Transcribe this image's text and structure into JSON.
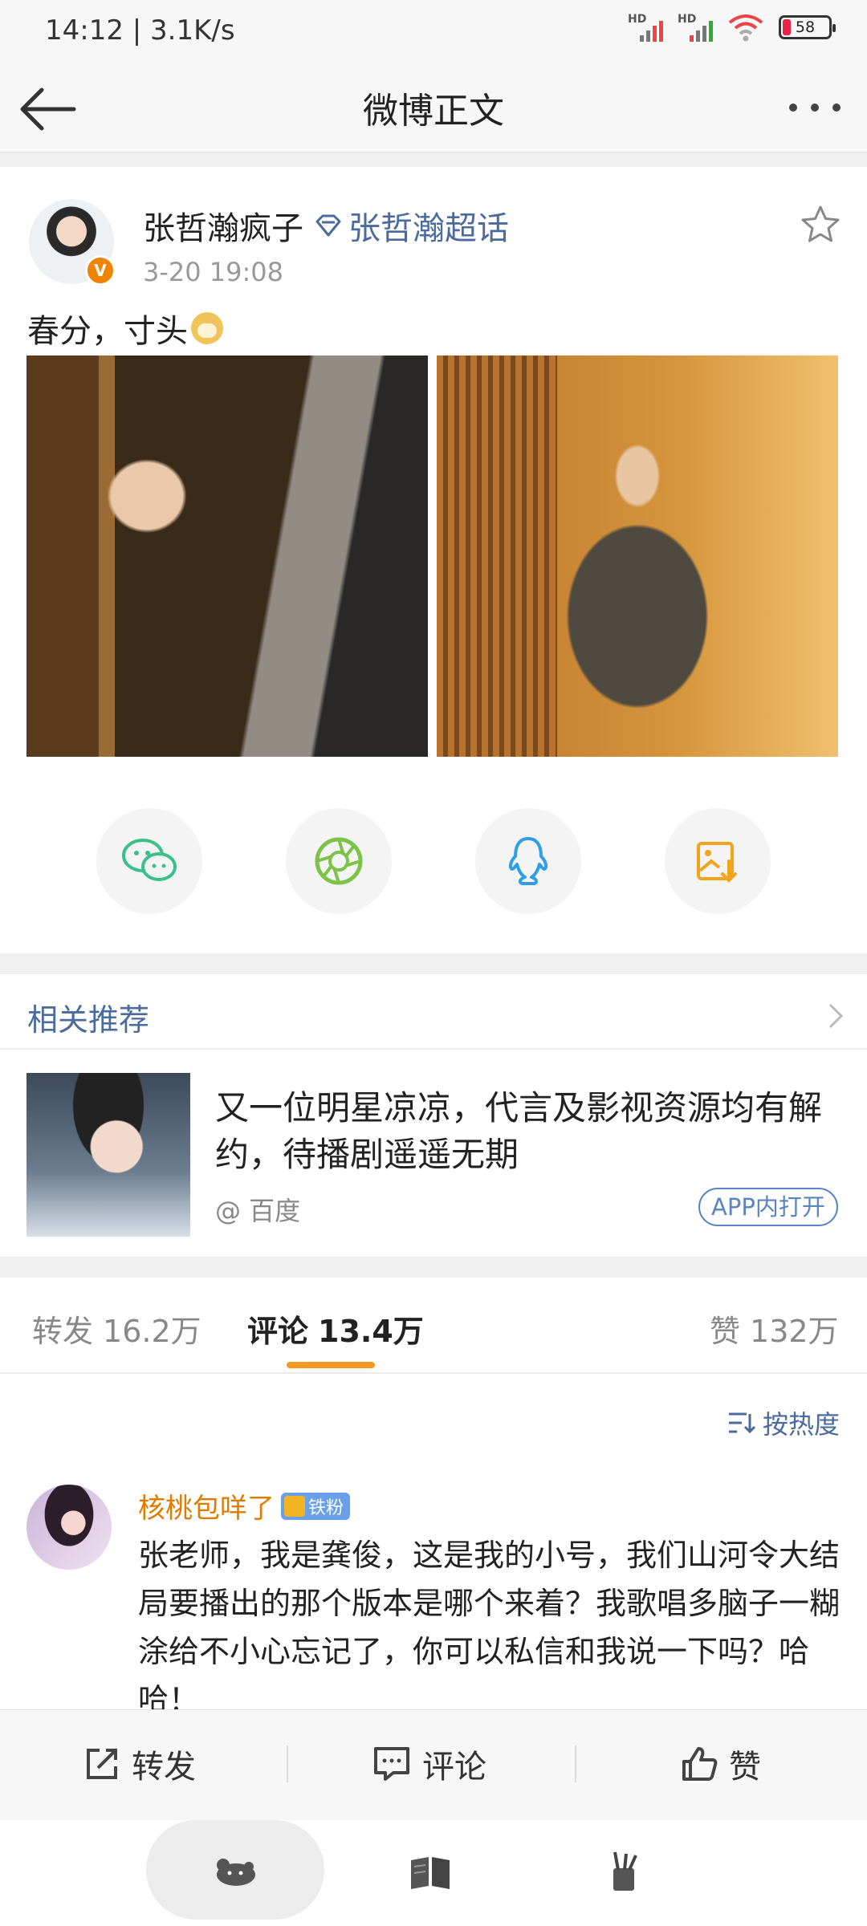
{
  "status_bar": {
    "time": "14:12 | 3.1K/s",
    "signal1_label": "HD",
    "signal2_label": "HD",
    "battery": "58"
  },
  "navbar": {
    "title": "微博正文"
  },
  "post": {
    "author": "张哲瀚疯子",
    "super_topic": "张哲瀚超话",
    "time": "3-20 19:08",
    "verified_badge": "V",
    "text": "春分，寸头",
    "emoji": "doge"
  },
  "share": {
    "items": [
      "wechat-icon",
      "moments-icon",
      "qq-icon",
      "save-image-icon"
    ]
  },
  "related": {
    "section_title": "相关推荐",
    "headline": "又一位明星凉凉，代言及影视资源均有解约，待播剧遥遥无期",
    "source": "@ 百度",
    "open_button": "APP内打开"
  },
  "tabs": {
    "repost": {
      "label": "转发",
      "count": "16.2万"
    },
    "comments": {
      "label": "评论",
      "count": "13.4万"
    },
    "likes": {
      "label": "赞",
      "count": "132万"
    }
  },
  "sort": {
    "label": "按热度"
  },
  "comment": {
    "author": "核桃包咩了",
    "fan_badge": "铁粉",
    "text": "张老师，我是龚俊，这是我的小号，我们山河令大结局要播出的那个版本是哪个来着？我歌唱多脑子一糊涂给不小心忘记了，你可以私信和我说一下吗？哈哈！"
  },
  "action_bar": {
    "repost": "转发",
    "comment": "评论",
    "like": "赞"
  },
  "colors": {
    "accent_orange": "#f59a23",
    "link_blue": "#4a6b9c",
    "name_orange": "#e07b00"
  }
}
